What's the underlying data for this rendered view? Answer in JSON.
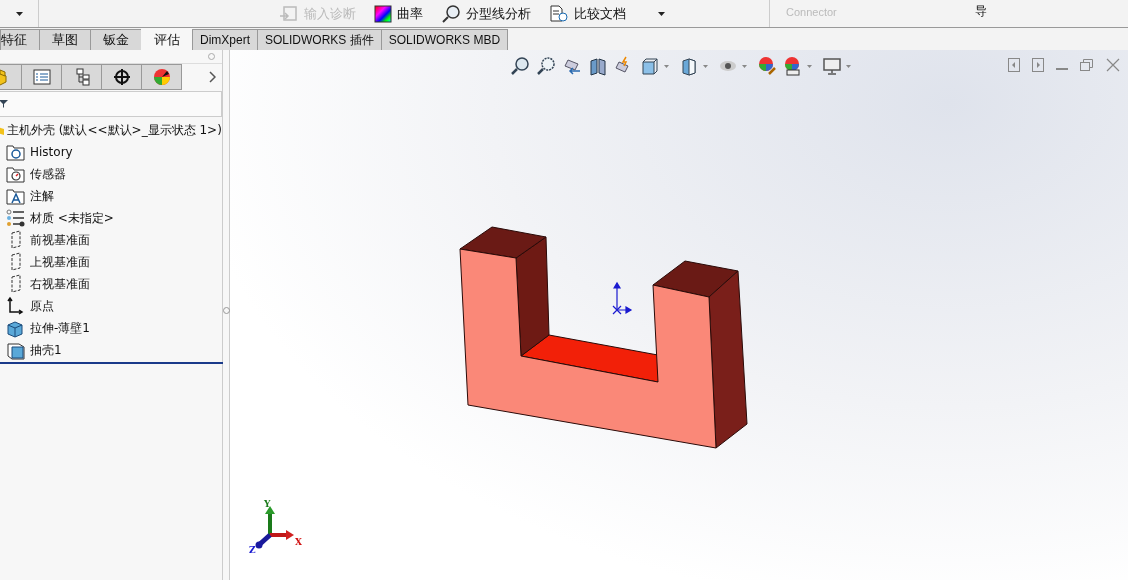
{
  "toolbar": {
    "commands": [
      {
        "label": "输入诊断",
        "disabled": true
      },
      {
        "label": "曲率",
        "disabled": false
      },
      {
        "label": "分型线分析",
        "disabled": false
      },
      {
        "label": "比较文档",
        "disabled": false
      }
    ],
    "clipped": [
      {
        "label": "Connector",
        "disabled": true
      },
      {
        "label": "导",
        "disabled": false
      }
    ]
  },
  "tabs": [
    {
      "label": "特征",
      "selected": false
    },
    {
      "label": "草图",
      "selected": false
    },
    {
      "label": "钣金",
      "selected": false
    },
    {
      "label": "评估",
      "selected": true
    },
    {
      "label": "DimXpert",
      "selected": false
    },
    {
      "label": "SOLIDWORKS 插件",
      "selected": false
    },
    {
      "label": "SOLIDWORKS MBD",
      "selected": false
    }
  ],
  "tree": {
    "root": "主机外壳 (默认<<默认>_显示状态 1>)",
    "items": [
      {
        "label": "History",
        "kind": "history"
      },
      {
        "label": "传感器",
        "kind": "sensor"
      },
      {
        "label": "注解",
        "kind": "annotation"
      },
      {
        "label": "材质 <未指定>",
        "kind": "material"
      },
      {
        "label": "前视基准面",
        "kind": "plane"
      },
      {
        "label": "上视基准面",
        "kind": "plane"
      },
      {
        "label": "右视基准面",
        "kind": "plane"
      },
      {
        "label": "原点",
        "kind": "origin"
      },
      {
        "label": "拉伸-薄壁1",
        "kind": "extrude"
      },
      {
        "label": "抽壳1",
        "kind": "shell"
      }
    ]
  },
  "triad": {
    "x": "X",
    "y": "Y",
    "z": "Z"
  }
}
